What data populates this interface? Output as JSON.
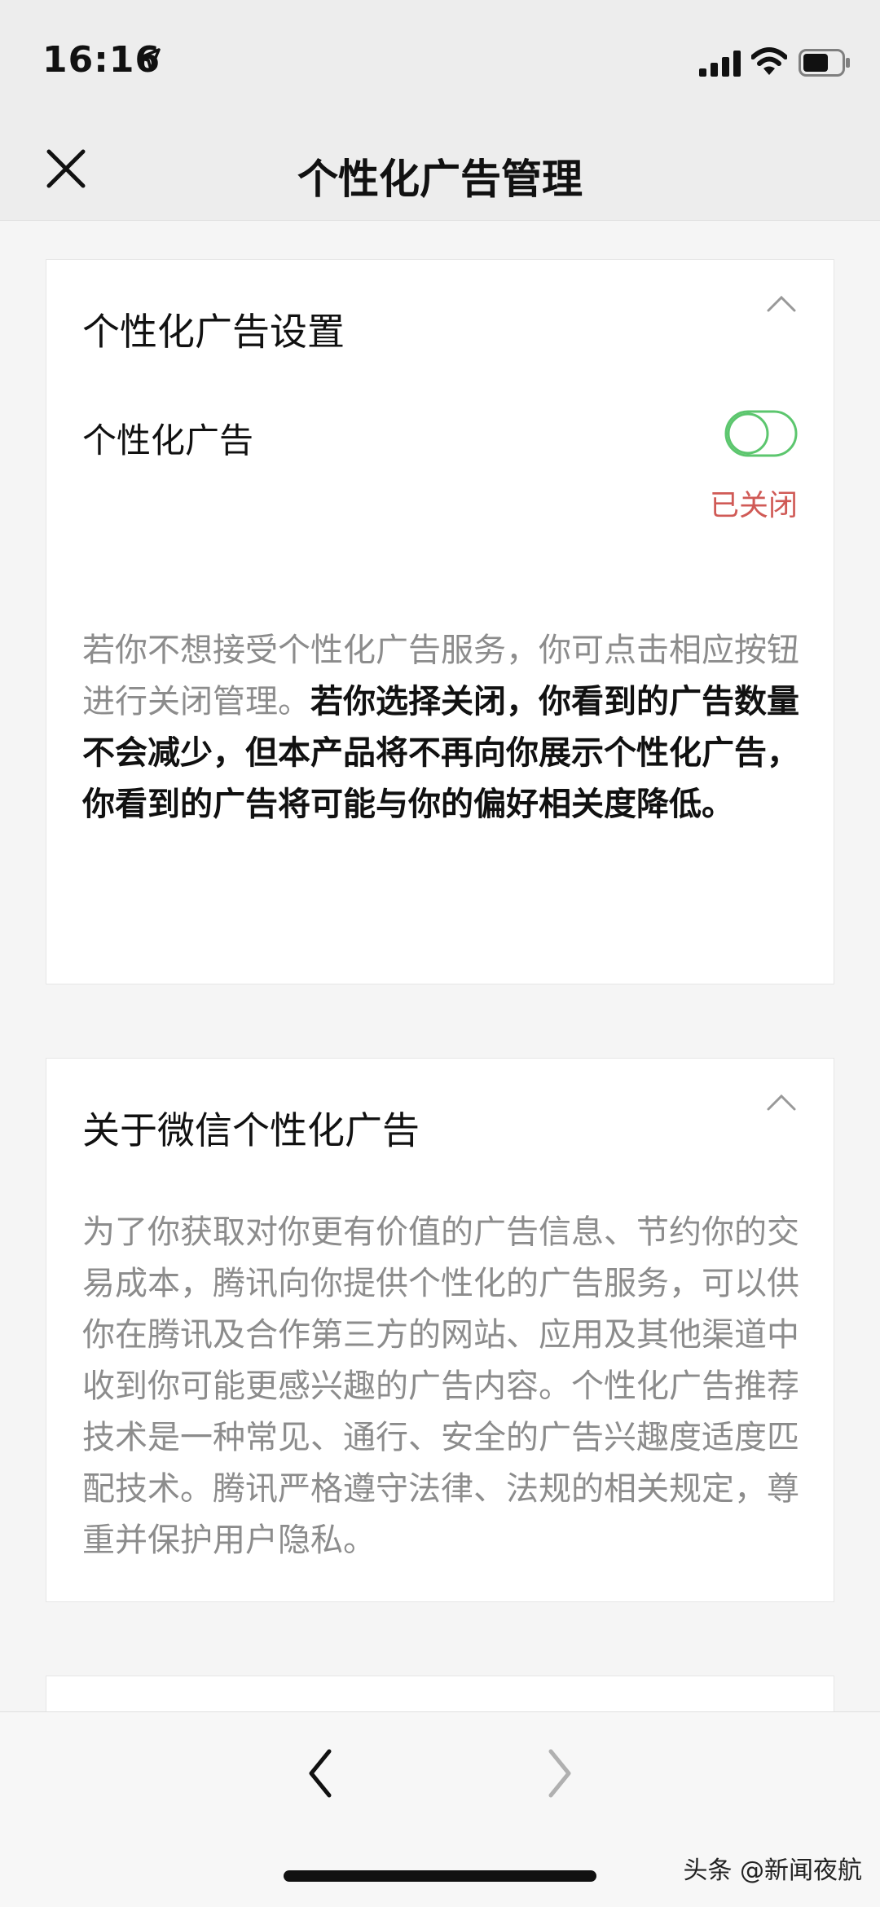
{
  "status_bar": {
    "time": "16:16",
    "icons": [
      "location-arrow-icon",
      "signal-icon",
      "wifi-icon",
      "battery-icon"
    ]
  },
  "nav": {
    "title": "个性化广告管理",
    "close_icon": "close-icon"
  },
  "settings_card": {
    "title": "个性化广告设置",
    "toggle_label": "个性化广告",
    "toggle_state": "已关闭",
    "toggle_on": false,
    "description_normal": "若你不想接受个性化广告服务，你可点击相应按钮进行关闭管理。",
    "description_bold": "若你选择关闭，你看到的广告数量不会减少，但本产品将不再向你展示个性化广告，你看到的广告将可能与你的偏好相关度降低。"
  },
  "about_card": {
    "title": "关于微信个性化广告",
    "description": "为了你获取对你更有价值的广告信息、节约你的交易成本，腾讯向你提供个性化的广告服务，可以供你在腾讯及合作第三方的网站、应用及其他渠道中收到你可能更感兴趣的广告内容。个性化广告推荐技术是一种常见、通行、安全的广告兴趣度适度匹配技术。腾讯严格遵守法律、法规的相关规定，尊重并保护用户隐私。"
  },
  "bottom_nav": {
    "back_icon": "chevron-left-icon",
    "forward_icon": "chevron-right-icon"
  },
  "watermark": "头条 @新闻夜航",
  "colors": {
    "toggle_green": "#5cc66e",
    "status_red": "#d05a56",
    "gray_text": "#8c8c8c"
  }
}
